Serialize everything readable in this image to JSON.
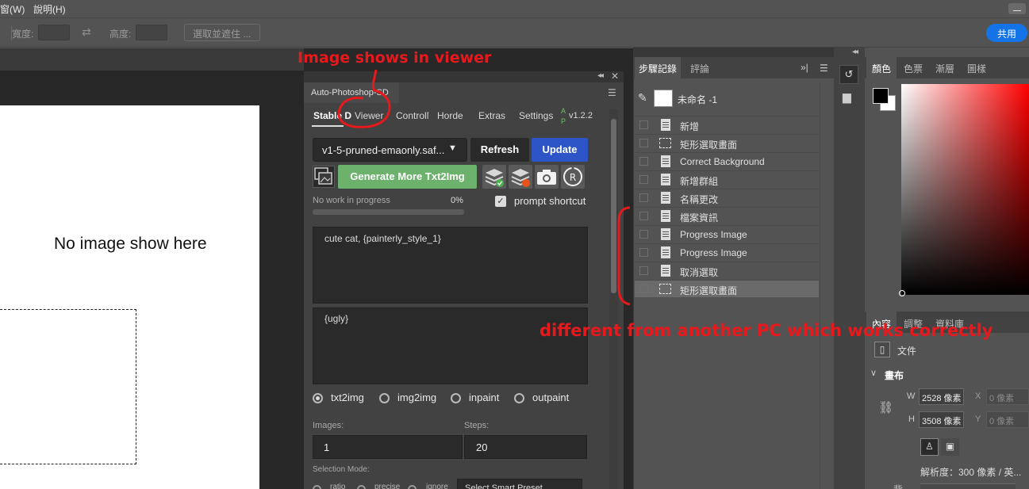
{
  "menubar": {
    "items": [
      "窗(W)",
      "說明(H)"
    ]
  },
  "options_bar": {
    "width_label": "寬度:",
    "height_label": "高度:",
    "select_mask_label": "選取並遮住 ...",
    "share_label": "共用"
  },
  "canvas": {
    "document_text": "No image show here"
  },
  "plugin": {
    "title": "Auto-Photoshop-SD",
    "tabs": [
      "Stable D",
      "Viewer",
      "ControlN",
      "Horde",
      "Extras",
      "Settings"
    ],
    "app_badge_a": "A",
    "app_badge_p": "P",
    "version": "v1.2.2",
    "model_select": "v1-5-pruned-emaonly.saf...",
    "refresh_label": "Refresh",
    "update_label": "Update",
    "generate_label": "Generate More Txt2Img",
    "progress_text": "No work in progress",
    "progress_percent": "0%",
    "progress_value": 0,
    "prompt_shortcut_label": "prompt shortcut",
    "prompt_shortcut_checked": true,
    "prompt": "cute cat, {painterly_style_1}",
    "negative_prompt": "{ugly}",
    "modes": [
      {
        "label": "txt2img",
        "selected": true
      },
      {
        "label": "img2img",
        "selected": false
      },
      {
        "label": "inpaint",
        "selected": false
      },
      {
        "label": "outpaint",
        "selected": false
      }
    ],
    "images_label": "Images:",
    "images_value": "1",
    "steps_label": "Steps:",
    "steps_value": "20",
    "selection_mode_label": "Selection Mode:",
    "selection_modes": [
      "ratio",
      "precise",
      "ignore"
    ],
    "smart_preset": "Select Smart Preset"
  },
  "history": {
    "tab_history": "步驟記錄",
    "tab_comments": "評論",
    "snapshot_label": "未命名 -1",
    "items": [
      {
        "label": "新增",
        "icon": "document-icon",
        "selected": false
      },
      {
        "label": "矩形選取畫面",
        "icon": "marquee-icon",
        "selected": false
      },
      {
        "label": "Correct Background",
        "icon": "document-icon",
        "selected": false
      },
      {
        "label": "新增群組",
        "icon": "document-icon",
        "selected": false
      },
      {
        "label": "名稱更改",
        "icon": "document-icon",
        "selected": false
      },
      {
        "label": "檔案資訊",
        "icon": "document-icon",
        "selected": false
      },
      {
        "label": "Progress Image",
        "icon": "document-icon",
        "selected": false
      },
      {
        "label": "Progress Image",
        "icon": "document-icon",
        "selected": false
      },
      {
        "label": "取消選取",
        "icon": "document-icon",
        "selected": false
      },
      {
        "label": "矩形選取畫面",
        "icon": "marquee-icon",
        "selected": true
      }
    ]
  },
  "color_panel": {
    "tabs": [
      "顏色",
      "色票",
      "漸層",
      "圖樣"
    ],
    "foreground": "#000000",
    "background": "#ffffff",
    "hue": "#ff0000"
  },
  "properties": {
    "tabs": [
      "內容",
      "調整",
      "資料庫"
    ],
    "doc_label": "文件",
    "canvas_section": "畫布",
    "w_label": "W",
    "w_value": "2528 像素",
    "h_label": "H",
    "h_value": "3508 像素",
    "x_label": "X",
    "x_placeholder": "0 像素",
    "y_label": "Y",
    "y_placeholder": "0 像素",
    "resolution": "解析度：300 像素 / 英...",
    "cut_label": "背..."
  },
  "annotations": {
    "viewer_note": "Image shows in viewer",
    "pc_note": "different from another PC which works correctly",
    "color": "#e8191c"
  }
}
